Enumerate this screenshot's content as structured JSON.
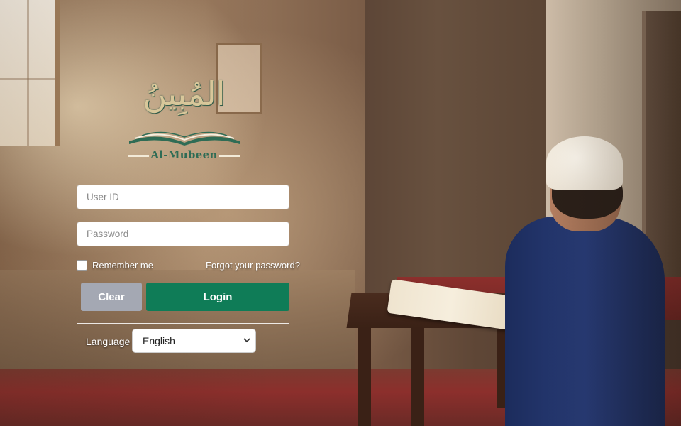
{
  "logo": {
    "arabic": "المُبِينُ",
    "name": "Al-Mubeen"
  },
  "login_form": {
    "userid_placeholder": "User ID",
    "password_placeholder": "Password",
    "remember_label": "Remember me",
    "forgot_link": "Forgot your password?",
    "clear_label": "Clear",
    "login_label": "Login",
    "clear_color": "#a4a8b3",
    "login_color": "#0f7c57"
  },
  "language": {
    "label": "Language",
    "selected": "English"
  }
}
